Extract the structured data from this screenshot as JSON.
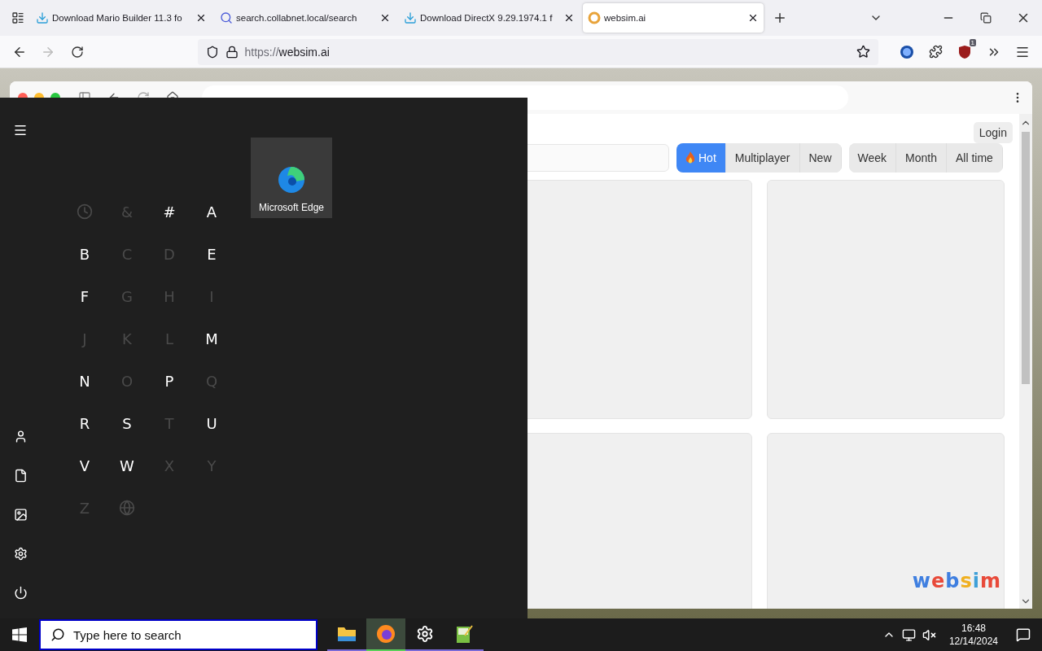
{
  "browser": {
    "tabs": [
      {
        "title": "Download Mario Builder 11.3 fo",
        "kind": "download",
        "selected": false
      },
      {
        "title": "search.collabnet.local/search",
        "kind": "search",
        "selected": false
      },
      {
        "title": "Download DirectX 9.29.1974.1 f",
        "kind": "download",
        "selected": false
      },
      {
        "title": "websim.ai",
        "kind": "site",
        "selected": true
      }
    ],
    "address": {
      "scheme": "https://",
      "host": "websim.ai"
    },
    "extension_badge": "1"
  },
  "site": {
    "login": "Login",
    "feed_tabs": [
      {
        "label": "Hot",
        "selected": true
      },
      {
        "label": "Multiplayer",
        "selected": false
      },
      {
        "label": "New",
        "selected": false
      }
    ],
    "time_tabs": [
      {
        "label": "Week",
        "selected": false
      },
      {
        "label": "Month",
        "selected": false
      },
      {
        "label": "All time",
        "selected": false
      }
    ],
    "cards": [
      {
        "kind": "blank"
      },
      {
        "kind": "blank"
      },
      {
        "kind": "blank"
      },
      {
        "kind": "blank"
      }
    ],
    "logo": "websim"
  },
  "start_menu": {
    "rail": [
      {
        "kind": "menu"
      },
      {
        "kind": "user"
      },
      {
        "kind": "documents"
      },
      {
        "kind": "pictures"
      },
      {
        "kind": "settings"
      },
      {
        "kind": "power"
      }
    ],
    "index": [
      {
        "kind": "recent",
        "disabled": true
      },
      {
        "kind": "letter",
        "label": "&",
        "disabled": true
      },
      {
        "kind": "letter",
        "label": "#",
        "disabled": false
      },
      {
        "kind": "letter",
        "label": "A",
        "disabled": false
      },
      {
        "kind": "letter",
        "label": "B",
        "disabled": false
      },
      {
        "kind": "letter",
        "label": "C",
        "disabled": true
      },
      {
        "kind": "letter",
        "label": "D",
        "disabled": true
      },
      {
        "kind": "letter",
        "label": "E",
        "disabled": false
      },
      {
        "kind": "letter",
        "label": "F",
        "disabled": false
      },
      {
        "kind": "letter",
        "label": "G",
        "disabled": true
      },
      {
        "kind": "letter",
        "label": "H",
        "disabled": true
      },
      {
        "kind": "letter",
        "label": "I",
        "disabled": true
      },
      {
        "kind": "letter",
        "label": "J",
        "disabled": true
      },
      {
        "kind": "letter",
        "label": "K",
        "disabled": true
      },
      {
        "kind": "letter",
        "label": "L",
        "disabled": true
      },
      {
        "kind": "letter",
        "label": "M",
        "disabled": false
      },
      {
        "kind": "letter",
        "label": "N",
        "disabled": false
      },
      {
        "kind": "letter",
        "label": "O",
        "disabled": true
      },
      {
        "kind": "letter",
        "label": "P",
        "disabled": false
      },
      {
        "kind": "letter",
        "label": "Q",
        "disabled": true
      },
      {
        "kind": "letter",
        "label": "R",
        "disabled": false
      },
      {
        "kind": "letter",
        "label": "S",
        "disabled": false
      },
      {
        "kind": "letter",
        "label": "T",
        "disabled": true
      },
      {
        "kind": "letter",
        "label": "U",
        "disabled": false
      },
      {
        "kind": "letter",
        "label": "V",
        "disabled": false
      },
      {
        "kind": "letter",
        "label": "W",
        "disabled": false
      },
      {
        "kind": "letter",
        "label": "X",
        "disabled": true
      },
      {
        "kind": "letter",
        "label": "Y",
        "disabled": true
      },
      {
        "kind": "letter",
        "label": "Z",
        "disabled": true
      },
      {
        "kind": "other",
        "disabled": true
      }
    ],
    "tiles": [
      {
        "label": "Microsoft Edge"
      }
    ]
  },
  "taskbar": {
    "search_placeholder": "Type here to search",
    "apps": [
      {
        "kind": "explorer",
        "selected": false
      },
      {
        "kind": "firefox",
        "selected": true
      },
      {
        "kind": "settings",
        "selected": false
      },
      {
        "kind": "notepad",
        "selected": false
      }
    ],
    "time": "16:48",
    "date": "12/14/2024"
  }
}
